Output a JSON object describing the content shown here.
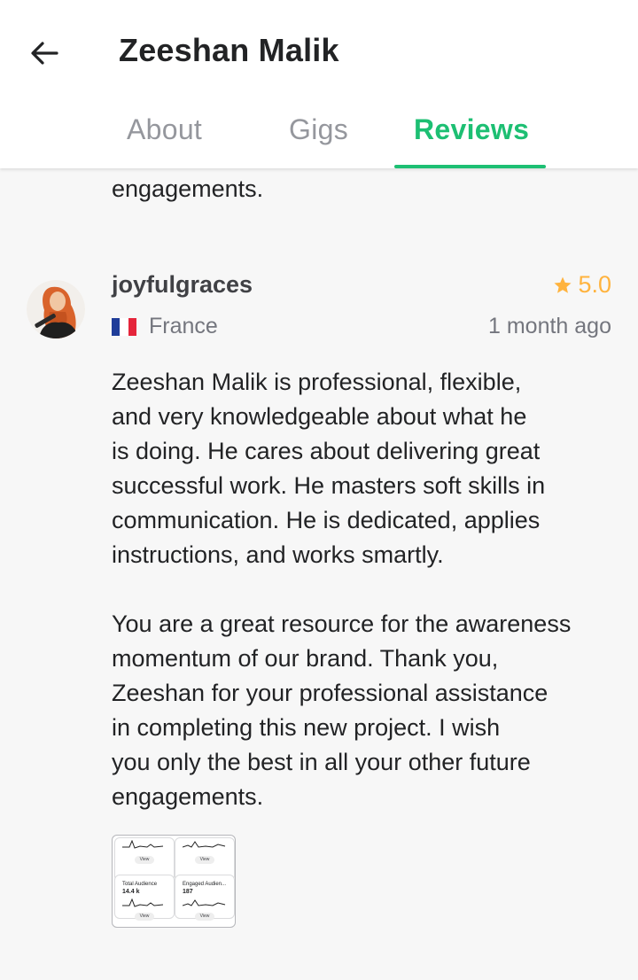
{
  "header": {
    "title": "Zeeshan Malik",
    "back_icon": "arrow-left-icon"
  },
  "tabs": [
    {
      "label": "About"
    },
    {
      "label": "Gigs"
    },
    {
      "label": "Reviews",
      "active": true
    }
  ],
  "colors": {
    "accent": "#1dbf73",
    "star": "#ffb33e",
    "muted": "#74767e"
  },
  "previous_review_tail": "engagements.",
  "review": {
    "reviewer": "joyfulgraces",
    "rating": "5.0",
    "country": "France",
    "country_flag_icon": "france-flag-icon",
    "time_ago": "1 month ago",
    "body": "Zeeshan Malik is professional, flexible,\nand very knowledgeable about what he\nis doing. He cares about delivering great\nsuccessful work. He masters soft skills in\ncommunication. He is dedicated, applies\ninstructions, and works smartly.\n\nYou are a great resource for the awareness\nmomentum of our brand.  Thank you,\nZeeshan for your professional assistance\nin completing this new project. I wish\nyou only the best in all your other future\nengagements.",
    "attachment": {
      "cells": [
        {
          "label": "",
          "value": "",
          "view": "View"
        },
        {
          "label": "",
          "value": "",
          "view": "View"
        },
        {
          "label": "Total Audience",
          "value": "14.4 k",
          "view": "View"
        },
        {
          "label": "Engaged Audien...",
          "value": "187",
          "view": "View"
        }
      ]
    }
  }
}
